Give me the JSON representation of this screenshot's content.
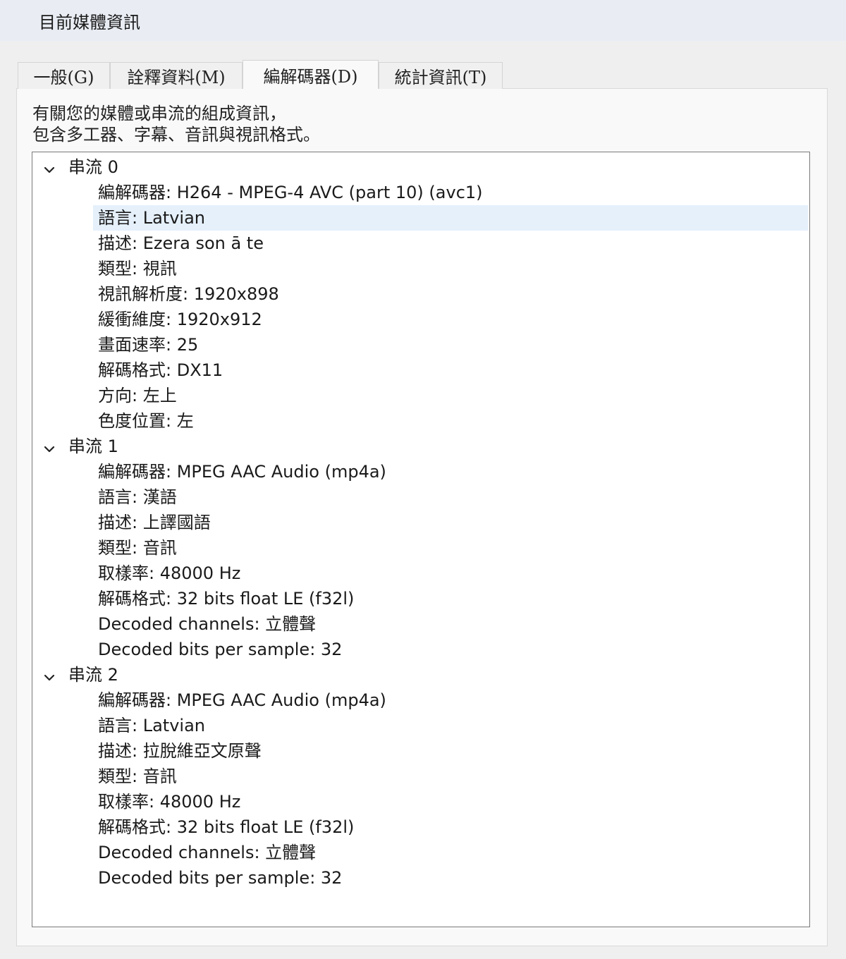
{
  "window": {
    "title": "目前媒體資訊"
  },
  "tabs": [
    {
      "label": "一般(G)",
      "active": false
    },
    {
      "label": "詮釋資料(M)",
      "active": false
    },
    {
      "label": "編解碼器(D)",
      "active": true
    },
    {
      "label": "統計資訊(T)",
      "active": false
    }
  ],
  "description": {
    "line1": "有關您的媒體或串流的組成資訊，",
    "line2": "包含多工器、字幕、音訊與視訊格式。"
  },
  "streams": [
    {
      "label": "串流 0",
      "items": [
        "編解碼器: H264 - MPEG-4 AVC (part 10) (avc1)",
        "語言: Latvian",
        "描述: Ezera son ā te",
        "類型: 視訊",
        "視訊解析度: 1920x898",
        "緩衝維度: 1920x912",
        "畫面速率: 25",
        "解碼格式: DX11",
        "方向: 左上",
        "色度位置: 左"
      ]
    },
    {
      "label": "串流 1",
      "items": [
        "編解碼器: MPEG AAC Audio (mp4a)",
        "語言: 漢語",
        "描述: 上譯國語",
        "類型: 音訊",
        "取樣率: 48000 Hz",
        "解碼格式: 32 bits float LE (f32l)",
        "Decoded channels: 立體聲",
        "Decoded bits per sample: 32"
      ]
    },
    {
      "label": "串流 2",
      "items": [
        "編解碼器: MPEG AAC Audio (mp4a)",
        "語言: Latvian",
        "描述: 拉脫維亞文原聲",
        "類型: 音訊",
        "取樣率: 48000 Hz",
        "解碼格式: 32 bits float LE (f32l)",
        "Decoded channels: 立體聲",
        "Decoded bits per sample: 32"
      ]
    }
  ],
  "selected_item": "語言: Latvian",
  "colors": {
    "selection": "#e5f0fb",
    "tree_border": "#7a7a7a",
    "panel_bg": "#f9f9f9"
  },
  "icons": {
    "expander": "chevron-down-icon"
  }
}
